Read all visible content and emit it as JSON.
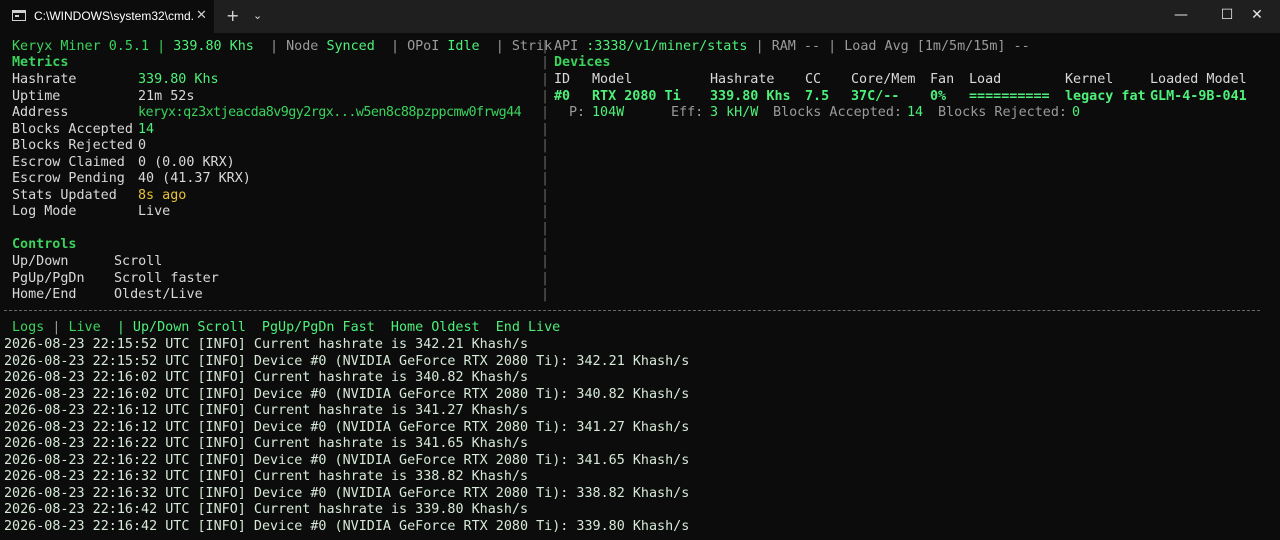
{
  "window": {
    "tab_title": "C:\\WINDOWS\\system32\\cmd.",
    "close_glyph": "✕",
    "new_tab_glyph": "+",
    "dropdown_glyph": "⌄",
    "min_glyph": "—",
    "max_glyph": "☐",
    "close_window_glyph": "✕"
  },
  "status": {
    "app": "Keryx Miner 0.5.1",
    "sep": "|",
    "hashrate": "339.80 Khs",
    "node_label": "Node",
    "node_value": "Synced",
    "opoi_label": "OPoI",
    "opoi_value": "Idle",
    "strike": "Strik",
    "api_label": "API",
    "api_value": ":3338/v1/miner/stats",
    "ram": "RAM --",
    "load": "Load Avg [1m/5m/15m] --"
  },
  "metrics": {
    "heading": "Metrics",
    "rows": [
      {
        "label": "Hashrate",
        "value": "339.80 Khs"
      },
      {
        "label": "Uptime",
        "value": "21m 52s"
      },
      {
        "label": "Address",
        "value": "keryx:qz3xtjeacda8v9gy2rgx...w5en8c88pzppcmw0frwg44"
      },
      {
        "label": "Blocks Accepted",
        "value": "14"
      },
      {
        "label": "Blocks Rejected",
        "value": "0"
      },
      {
        "label": "Escrow Claimed",
        "value": "0 (0.00 KRX)"
      },
      {
        "label": "Escrow Pending",
        "value": "40 (41.37 KRX)"
      },
      {
        "label": "Stats Updated",
        "value": "8s ago"
      },
      {
        "label": "Log Mode",
        "value": "Live"
      }
    ]
  },
  "controls": {
    "heading": "Controls",
    "rows": [
      {
        "key": "Up/Down",
        "action": "Scroll"
      },
      {
        "key": "PgUp/PgDn",
        "action": "Scroll faster"
      },
      {
        "key": "Home/End",
        "action": "Oldest/Live"
      }
    ]
  },
  "devices": {
    "heading": "Devices",
    "columns": [
      "ID",
      "Model",
      "Hashrate",
      "CC",
      "Core/Mem",
      "Fan",
      "Load",
      "Kernel",
      "Loaded Model"
    ],
    "row": {
      "id": "#0",
      "model": "RTX 2080 Ti",
      "hashrate": "339.80 Khs",
      "cc": "7.5",
      "coremem": "37C/--",
      "fan": "0%",
      "load": "==========",
      "kernel": "legacy fat",
      "loaded_model": "GLM-4-9B-041"
    },
    "detail": {
      "power_label": "P:",
      "power_value": "104W",
      "eff_label": "Eff:",
      "eff_value": "3 kH/W",
      "accepted_label": "Blocks Accepted:",
      "accepted_value": "14",
      "rejected_label": "Blocks Rejected:",
      "rejected_value": "0"
    }
  },
  "divider_glyph": "|",
  "logs_header": {
    "logs": "Logs",
    "live": "Live",
    "hints": "| Up/Down Scroll  PgUp/PgDn Fast  Home Oldest  End Live"
  },
  "logs": [
    "2026-08-23 22:15:52 UTC [INFO] Current hashrate is 342.21 Khash/s",
    "2026-08-23 22:15:52 UTC [INFO] Device #0 (NVIDIA GeForce RTX 2080 Ti): 342.21 Khash/s",
    "2026-08-23 22:16:02 UTC [INFO] Current hashrate is 340.82 Khash/s",
    "2026-08-23 22:16:02 UTC [INFO] Device #0 (NVIDIA GeForce RTX 2080 Ti): 340.82 Khash/s",
    "2026-08-23 22:16:12 UTC [INFO] Current hashrate is 341.27 Khash/s",
    "2026-08-23 22:16:12 UTC [INFO] Device #0 (NVIDIA GeForce RTX 2080 Ti): 341.27 Khash/s",
    "2026-08-23 22:16:22 UTC [INFO] Current hashrate is 341.65 Khash/s",
    "2026-08-23 22:16:22 UTC [INFO] Device #0 (NVIDIA GeForce RTX 2080 Ti): 341.65 Khash/s",
    "2026-08-23 22:16:32 UTC [INFO] Current hashrate is 338.82 Khash/s",
    "2026-08-23 22:16:32 UTC [INFO] Device #0 (NVIDIA GeForce RTX 2080 Ti): 338.82 Khash/s",
    "2026-08-23 22:16:42 UTC [INFO] Current hashrate is 339.80 Khash/s",
    "2026-08-23 22:16:42 UTC [INFO] Device #0 (NVIDIA GeForce RTX 2080 Ti): 339.80 Khash/s"
  ],
  "colors": {
    "background": "#0c0c0c",
    "titlebar": "#1f1f1f",
    "green": "#3ad35c",
    "bright_green": "#4ef07a",
    "yellow": "#e8c23a",
    "gray": "#9a9a9a"
  }
}
